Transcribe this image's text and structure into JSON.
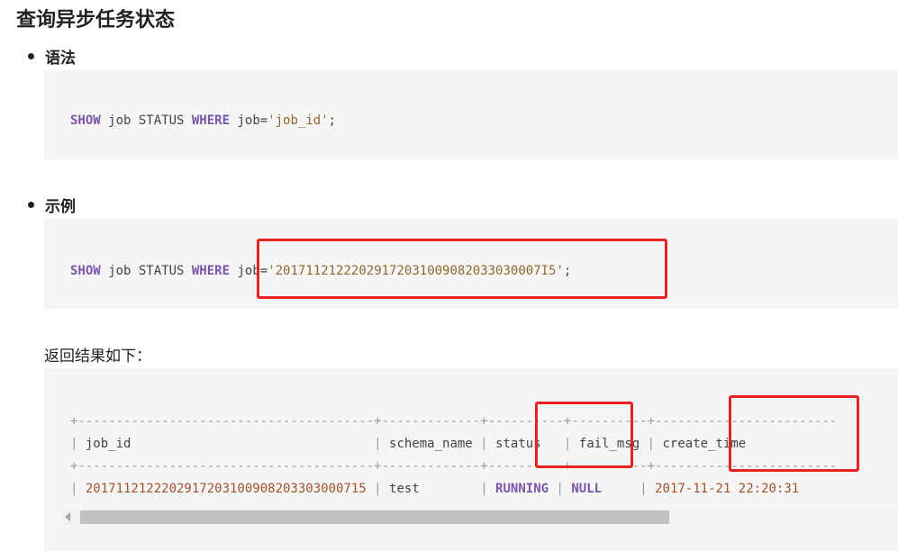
{
  "title": "查询异步任务状态",
  "syntax": {
    "heading": "语法",
    "kw_show": "SHOW",
    "job_status": " job STATUS ",
    "kw_where": "WHERE",
    "job_eq": " job=",
    "job_value": "'job_id'",
    "semicolon": ";"
  },
  "example": {
    "heading": "示例",
    "kw_show": "SHOW",
    "job_status": " job STATUS ",
    "kw_where": "WHERE",
    "job_eq": " job=",
    "job_value": "'20171121222029172031009082033030007I5'",
    "semicolon": ";"
  },
  "result_label": "返回结果如下：",
  "table": {
    "border_line": "+---------------------------------------+-------------+----------+----------+------------------------",
    "header": {
      "job_id": "job_id",
      "schema_name": "schema_name",
      "status": "status",
      "fail_msg": "fail_msg",
      "create_time": "create_time"
    },
    "row": {
      "job_id": "2017112122202917203100908203303000715",
      "schema_name": "test",
      "status": "RUNNING",
      "fail_msg": "NULL",
      "create_time": "2017-11-21 22:20:31"
    }
  },
  "colors": {
    "keyword": "#7b55a8",
    "string": "#8c6a2f",
    "highlight": "#e8231f",
    "code_bg": "#f5f5f5"
  }
}
